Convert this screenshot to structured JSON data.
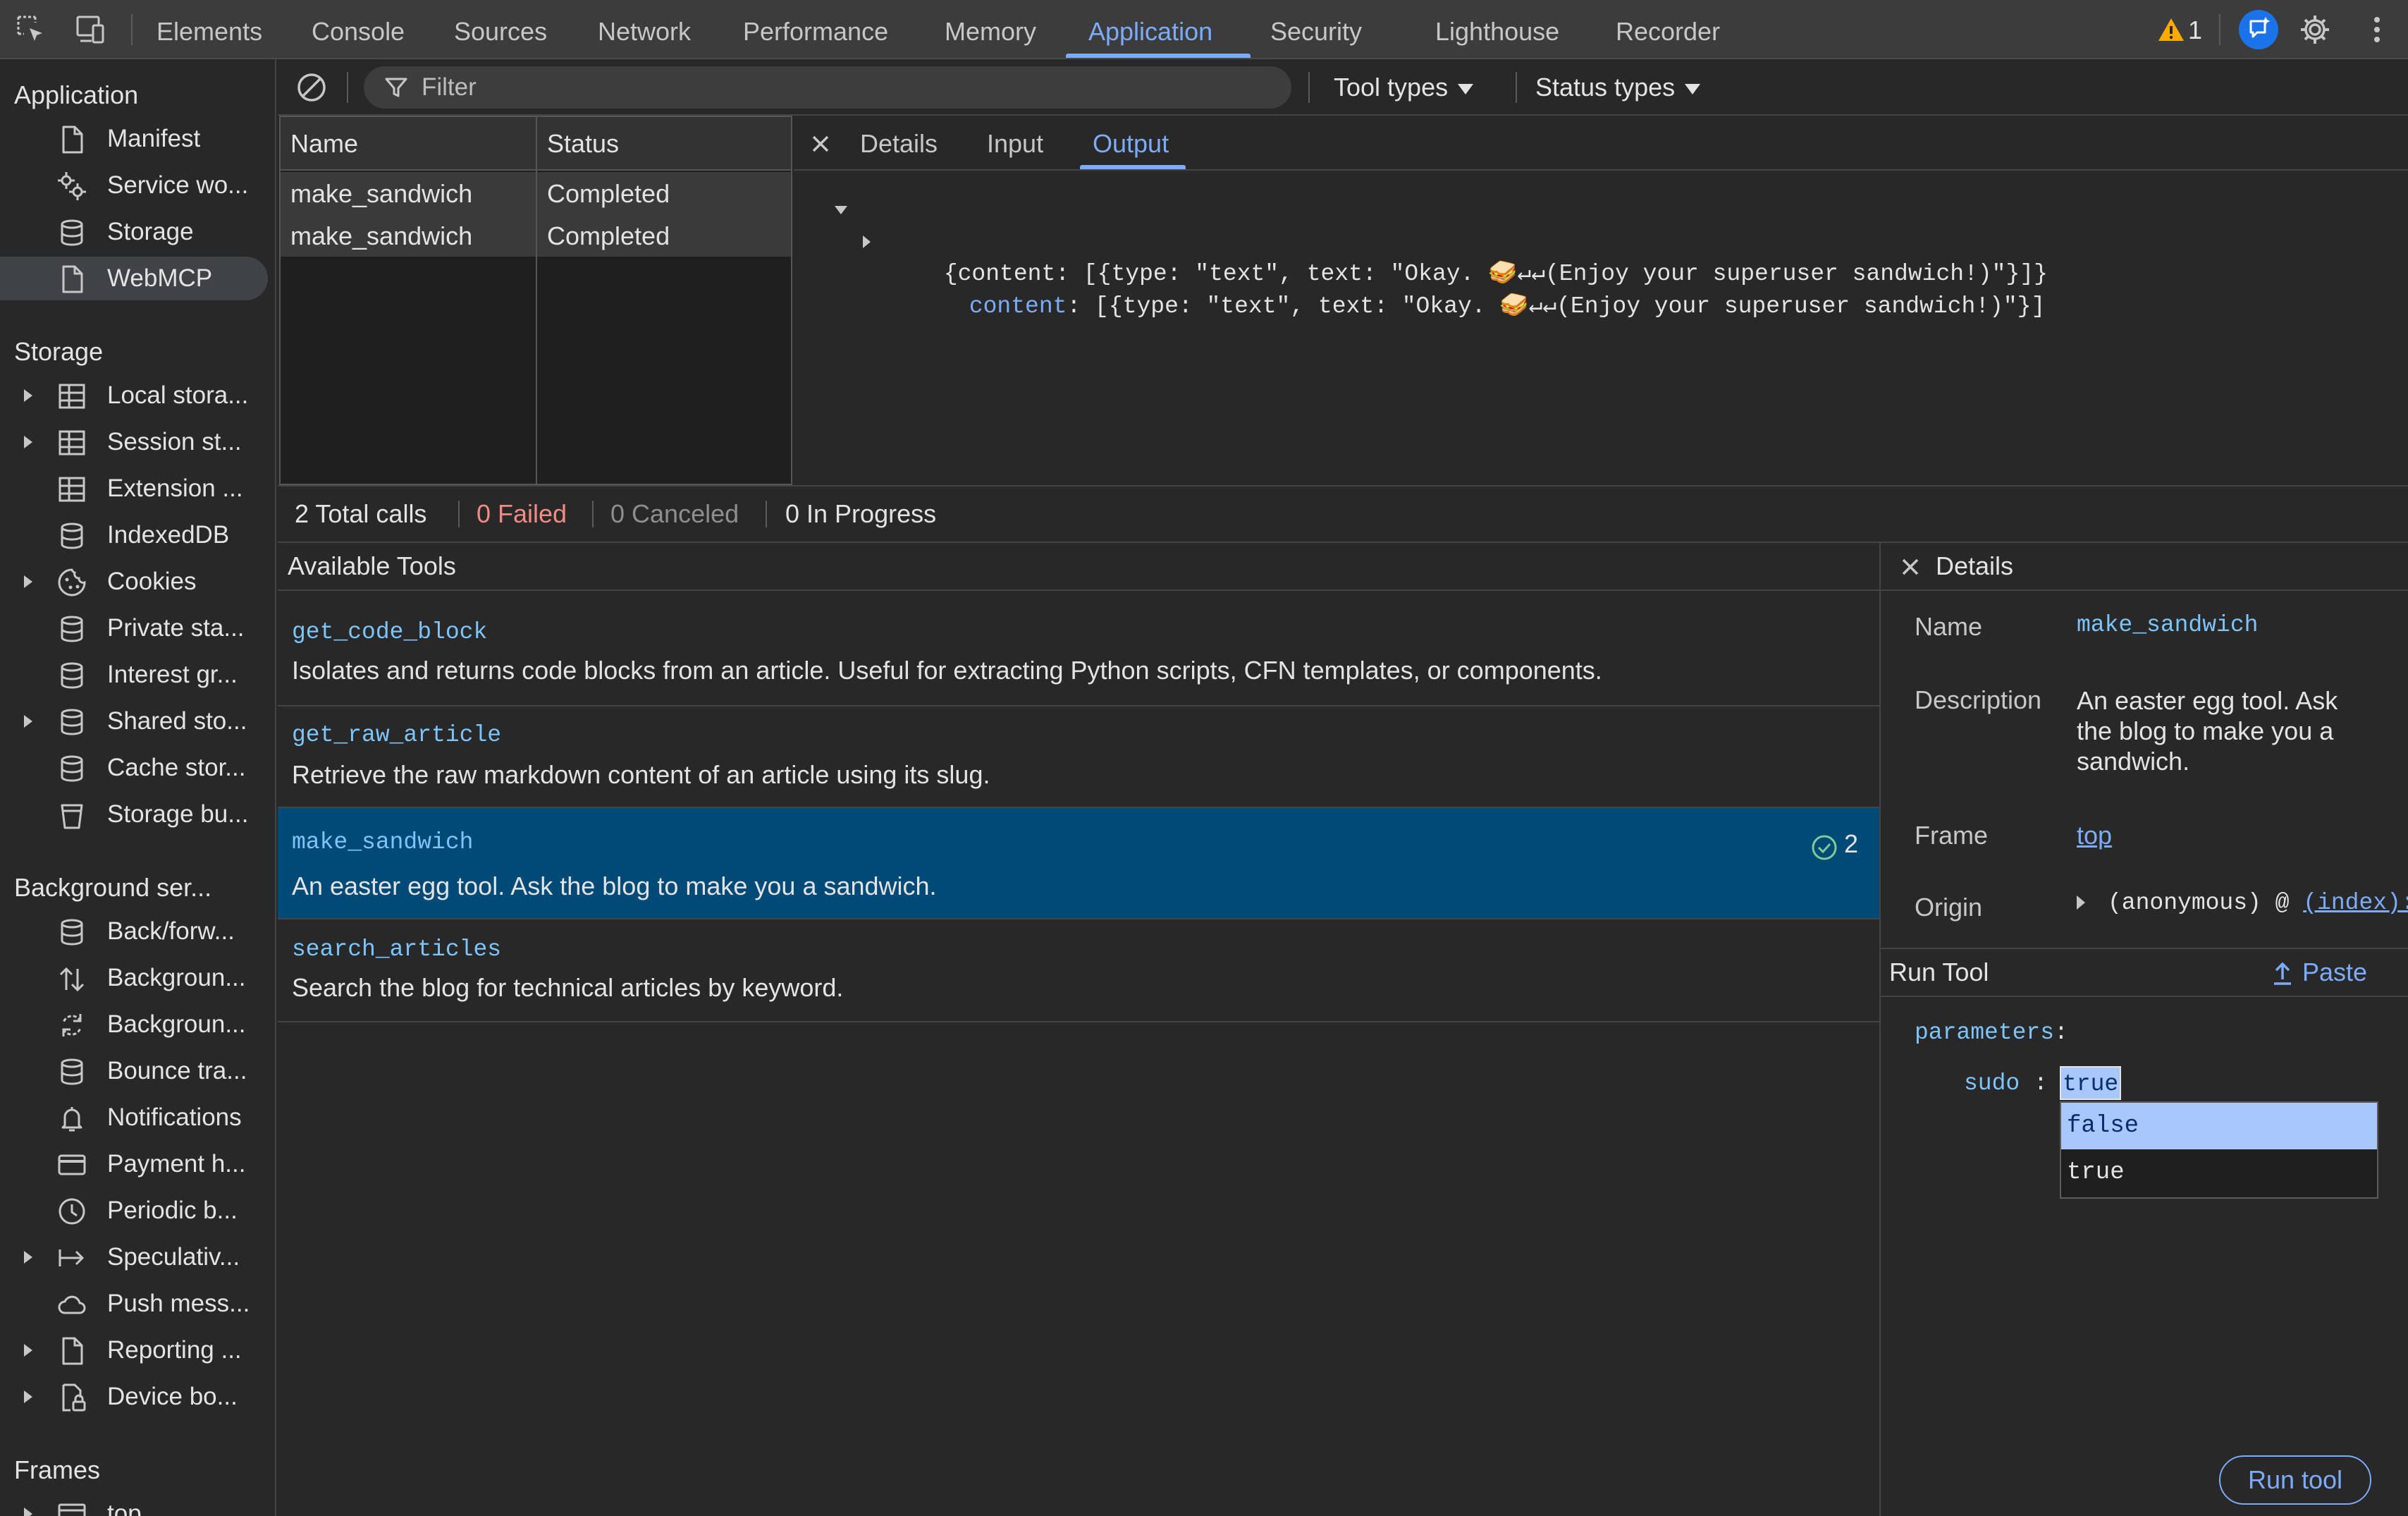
{
  "toolbar": {
    "tabs": [
      "Elements",
      "Console",
      "Sources",
      "Network",
      "Performance",
      "Memory",
      "Application",
      "Security",
      "Lighthouse",
      "Recorder"
    ],
    "active_tab": "Application",
    "warning_count": "1"
  },
  "sidebar": {
    "application_header": "Application",
    "application_items": [
      "Manifest",
      "Service wo...",
      "Storage",
      "WebMCP"
    ],
    "selected_item": "WebMCP",
    "storage_header": "Storage",
    "storage_items": [
      "Local stora...",
      "Session st...",
      "Extension ...",
      "IndexedDB",
      "Cookies",
      "Private sta...",
      "Interest gr...",
      "Shared sto...",
      "Cache stor...",
      "Storage bu..."
    ],
    "background_header": "Background ser...",
    "background_items": [
      "Back/forw...",
      "Backgroun...",
      "Backgroun...",
      "Bounce tra...",
      "Notifications",
      "Payment h...",
      "Periodic b...",
      "Speculativ...",
      "Push mess...",
      "Reporting ...",
      "Device bo..."
    ],
    "frames_header": "Frames",
    "frames_items": [
      "top"
    ]
  },
  "filter": {
    "placeholder": "Filter",
    "tool_types": "Tool types",
    "status_types": "Status types"
  },
  "calls": {
    "headers": [
      "Name",
      "Status"
    ],
    "rows": [
      {
        "name": "make_sandwich",
        "status": "Completed"
      },
      {
        "name": "make_sandwich",
        "status": "Completed"
      }
    ]
  },
  "detail_tabs": {
    "tabs": [
      "Details",
      "Input",
      "Output"
    ],
    "active": "Output"
  },
  "output": {
    "line1": "{content: [{type: \"text\", text: \"Okay. 🥪↵↵(Enjoy your superuser sandwich!)\"}]}",
    "line2_key": "content",
    "line2_rest": ": [{type: \"text\", text: \"Okay. 🥪↵↵(Enjoy your superuser sandwich!)\"}]"
  },
  "summary": {
    "total": "2 Total calls",
    "failed": "0 Failed",
    "canceled": "0 Canceled",
    "in_progress": "0 In Progress"
  },
  "tools": {
    "header": "Available Tools",
    "items": [
      {
        "name": "get_code_block",
        "description": "Isolates and returns code blocks from an article. Useful for extracting Python scripts, CFN templates, or components."
      },
      {
        "name": "get_raw_article",
        "description": "Retrieve the raw markdown content of an article using its slug."
      },
      {
        "name": "make_sandwich",
        "description": "An easter egg tool. Ask the blog to make you a sandwich.",
        "count": "2"
      },
      {
        "name": "search_articles",
        "description": "Search the blog for technical articles by keyword."
      }
    ]
  },
  "details": {
    "title": "Details",
    "name_label": "Name",
    "name_value": "make_sandwich",
    "description_label": "Description",
    "description_value": "An easter egg tool. Ask the blog to make you a sandwich.",
    "frame_label": "Frame",
    "frame_value": "top",
    "origin_label": "Origin",
    "origin_prefix": "(anonymous) @ ",
    "origin_link": "(index):"
  },
  "run_tool": {
    "title": "Run Tool",
    "paste_label": "Paste",
    "parameters_label": "parameters",
    "param_name": "sudo",
    "param_value": "true",
    "options": [
      "false",
      "true"
    ],
    "highlighted_option": "false",
    "run_button": "Run tool"
  },
  "colors": {
    "accent": "#7cacf8",
    "selected_row": "#004a77",
    "failed": "#f28b82",
    "warning": "#f9ab00"
  }
}
